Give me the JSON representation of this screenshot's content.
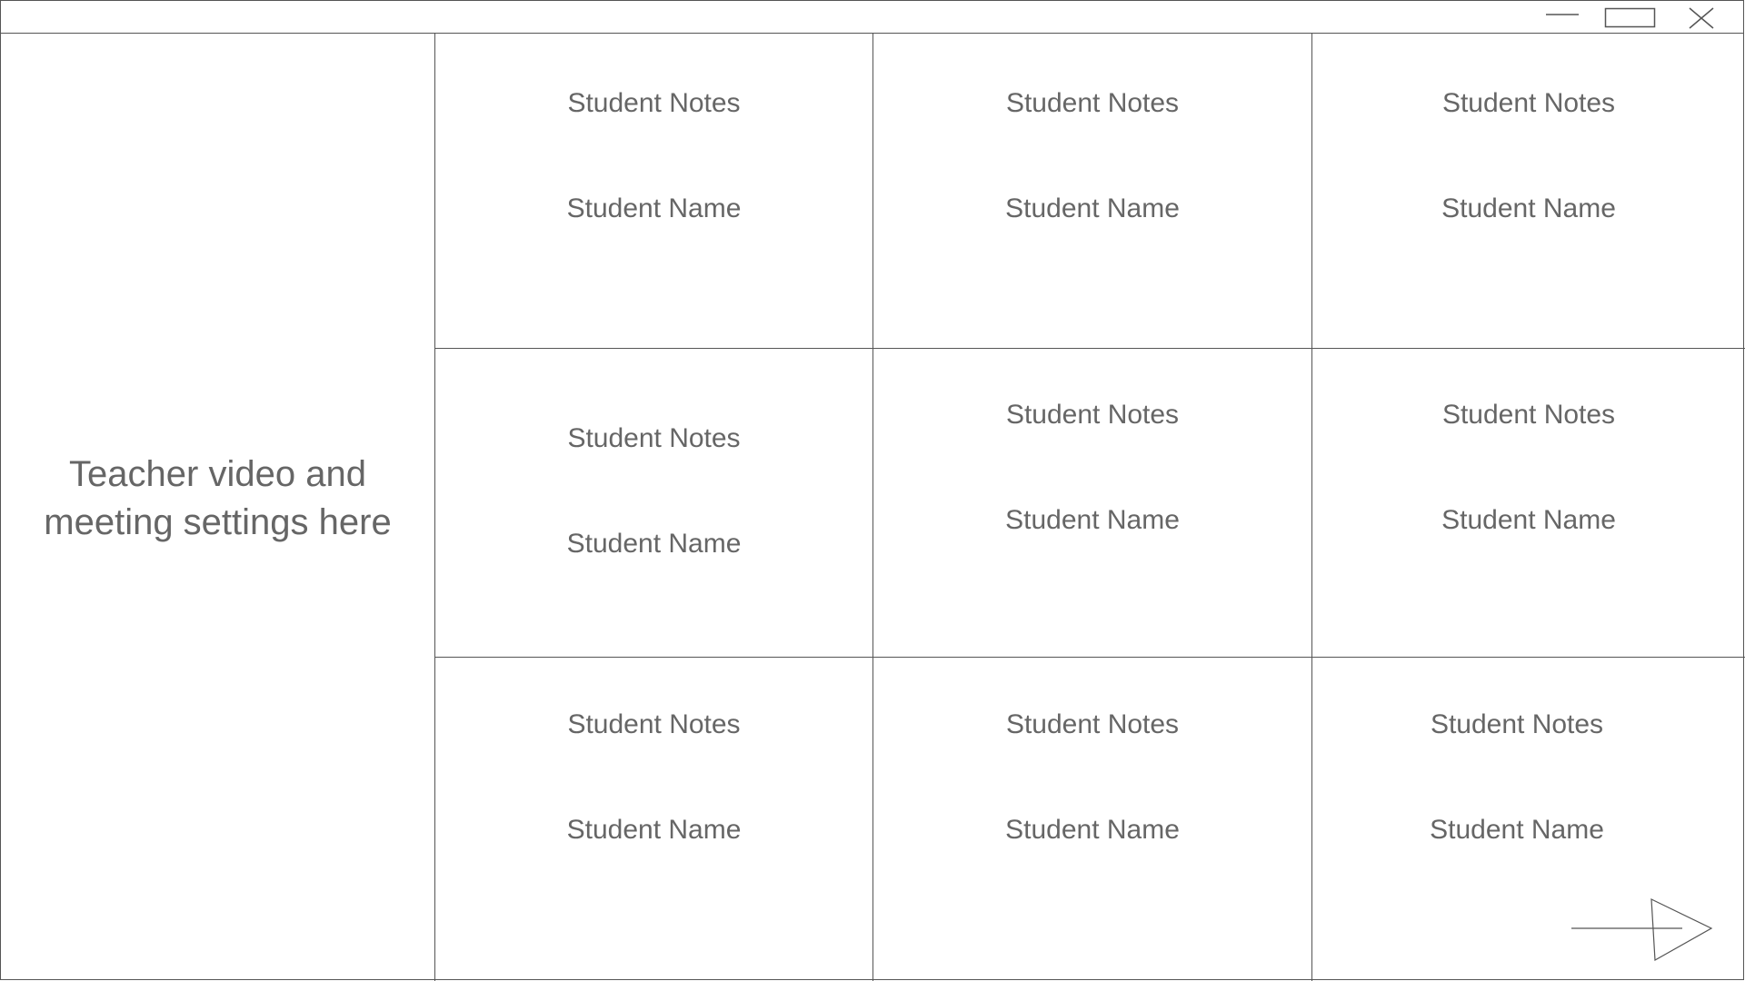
{
  "window": {
    "controls": {
      "minimize": "minimize-icon",
      "maximize": "maximize-icon",
      "close": "close-icon"
    }
  },
  "sidebar": {
    "teacher_panel_line1": "Teacher video and",
    "teacher_panel_line2": "meeting settings here"
  },
  "students": [
    {
      "notes": "Student Notes",
      "name": "Student Name"
    },
    {
      "notes": "Student Notes",
      "name": "Student Name"
    },
    {
      "notes": "Student Notes",
      "name": "Student Name"
    },
    {
      "notes": "Student Notes",
      "name": "Student Name"
    },
    {
      "notes": "Student Notes",
      "name": "Student Name"
    },
    {
      "notes": "Student Notes",
      "name": "Student Name"
    },
    {
      "notes": "Student Notes",
      "name": "Student Name"
    },
    {
      "notes": "Student Notes",
      "name": "Student Name"
    },
    {
      "notes": "Student Notes",
      "name": "Student Name"
    }
  ],
  "navigation": {
    "next_icon": "arrow-right-icon"
  },
  "colors": {
    "line": "#555555",
    "text": "#666666",
    "background": "#ffffff"
  }
}
